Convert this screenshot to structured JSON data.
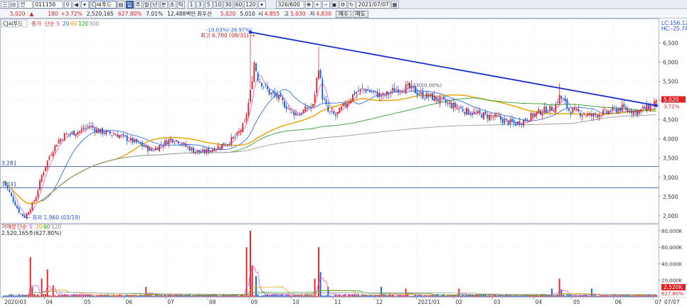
{
  "toolbar": {
    "menu_buttons": [
      "三",
      "⊟"
    ],
    "market": "전",
    "code": "011150",
    "stock_name": "CJ씨푸드",
    "periods": [
      "주",
      "월",
      "년",
      "분",
      "초",
      "틱"
    ],
    "intervals": [
      "1",
      "3",
      "5",
      "10",
      "30",
      "60",
      "120"
    ],
    "candle_count": "326/600",
    "date": "2021/07/07"
  },
  "quote": {
    "price": "5,020",
    "arrow": "▲",
    "change": "180",
    "change_pct": "+3.72%",
    "volume": "2,520,165",
    "vol_ratio": "627.80%",
    "turnover": "7.01%",
    "amount": "12,488백만",
    "bid_label": "최우선",
    "ask_price": "5,020",
    "bid_price": "5,010",
    "high_label": "시",
    "open": "4,855",
    "high2_label": "고",
    "high": "5,030",
    "low_label": "저",
    "low": "4,830",
    "buy_label": "매수",
    "sell_label": "매도"
  },
  "chart_data": {
    "type": "candlestick",
    "title": "CJ씨푸드",
    "price_legend": [
      "종가",
      "단순",
      "5",
      "20",
      "60",
      "120",
      "300"
    ],
    "volume_legend": [
      "거래량",
      "단순",
      "5",
      "20",
      "60",
      "120"
    ],
    "volume_value": "2,520,165주(627.80%)",
    "hc_label": "HC:-25.74",
    "lc_label": "LC:156.12",
    "y_ticks": [
      2000,
      2500,
      3000,
      3500,
      4000,
      4500,
      5000,
      5500,
      6000,
      6500
    ],
    "y_tick_labels": [
      "2,000",
      "2,500",
      "3,000",
      "3,500",
      "4,000",
      "4,500",
      "5,000",
      "5,500",
      "6,000",
      "6,500"
    ],
    "ylim": [
      1850,
      7100
    ],
    "vol_ticks": [
      20000,
      40000,
      60000,
      80000
    ],
    "vol_tick_labels": [
      "20,000K",
      "40,000K",
      "60,000K",
      "80,000K"
    ],
    "vol_max": 86000,
    "x_labels": [
      "2020/03",
      "04",
      "05",
      "06",
      "07",
      "08",
      "09",
      "10",
      "11",
      "12",
      "2021/01",
      "02",
      "03",
      "04",
      "05",
      "06",
      "07"
    ],
    "last_x_label": "07/07",
    "current_price": 5020,
    "current_price_label": "5,020",
    "current_pct_label": "3.72%",
    "current_vol_label": "2,520K",
    "current_vol_pct_label": "627.80%",
    "annotations": {
      "high": {
        "label": "최고 6,780 (08/31)",
        "pct": "-10.03%(-26.97%)",
        "value": 6780
      },
      "low": {
        "label": "최저 1,960 (03/19)",
        "value": 1960
      },
      "mid": {
        "label": "5,330(0.00%)",
        "value": 5330
      }
    },
    "hlines": [
      {
        "value": 3280,
        "label": "3,281"
      },
      {
        "value": 2730,
        "label": "3,031"
      }
    ],
    "trendline": {
      "from": 6780,
      "to": 4870
    },
    "anchor_points": [
      [
        0,
        2900
      ],
      [
        4,
        2500
      ],
      [
        8,
        2100
      ],
      [
        11,
        1960
      ],
      [
        14,
        2200
      ],
      [
        17,
        2500
      ],
      [
        20,
        3050
      ],
      [
        24,
        3550
      ],
      [
        28,
        3900
      ],
      [
        32,
        4100
      ],
      [
        36,
        4150
      ],
      [
        40,
        4200
      ],
      [
        45,
        4350
      ],
      [
        50,
        4200
      ],
      [
        55,
        4150
      ],
      [
        60,
        4100
      ],
      [
        65,
        4000
      ],
      [
        70,
        3900
      ],
      [
        74,
        3800
      ],
      [
        78,
        3700
      ],
      [
        83,
        3850
      ],
      [
        88,
        4000
      ],
      [
        92,
        3950
      ],
      [
        96,
        3800
      ],
      [
        100,
        3700
      ],
      [
        104,
        3650
      ],
      [
        108,
        3700
      ],
      [
        113,
        3800
      ],
      [
        118,
        3900
      ],
      [
        123,
        4100
      ],
      [
        127,
        4400
      ],
      [
        130,
        5200
      ],
      [
        132,
        6000
      ],
      [
        134,
        5600
      ],
      [
        137,
        5400
      ],
      [
        140,
        5200
      ],
      [
        144,
        5100
      ],
      [
        148,
        4900
      ],
      [
        152,
        4700
      ],
      [
        156,
        4650
      ],
      [
        160,
        4800
      ],
      [
        163,
        4850
      ],
      [
        166,
        5900
      ],
      [
        168,
        5100
      ],
      [
        171,
        4700
      ],
      [
        175,
        4600
      ],
      [
        180,
        4900
      ],
      [
        185,
        5200
      ],
      [
        190,
        5300
      ],
      [
        195,
        5200
      ],
      [
        200,
        5100
      ],
      [
        205,
        5250
      ],
      [
        210,
        5350
      ],
      [
        215,
        5300
      ],
      [
        220,
        5150
      ],
      [
        225,
        5100
      ],
      [
        230,
        5000
      ],
      [
        235,
        4900
      ],
      [
        240,
        4800
      ],
      [
        245,
        4700
      ],
      [
        250,
        4650
      ],
      [
        255,
        4600
      ],
      [
        260,
        4550
      ],
      [
        265,
        4450
      ],
      [
        270,
        4400
      ],
      [
        275,
        4500
      ],
      [
        280,
        4650
      ],
      [
        285,
        4750
      ],
      [
        290,
        4800
      ],
      [
        293,
        5100
      ],
      [
        295,
        5000
      ],
      [
        298,
        4750
      ],
      [
        302,
        4700
      ],
      [
        306,
        4650
      ],
      [
        310,
        4600
      ],
      [
        314,
        4650
      ],
      [
        318,
        4700
      ],
      [
        322,
        4750
      ],
      [
        326,
        4800
      ],
      [
        330,
        4750
      ],
      [
        334,
        4700
      ],
      [
        338,
        4800
      ],
      [
        341,
        4870
      ],
      [
        343,
        4950
      ],
      [
        344,
        5020
      ]
    ],
    "volume_spikes": [
      [
        14,
        48000
      ],
      [
        15,
        12000
      ],
      [
        20,
        22000
      ],
      [
        23,
        33000
      ],
      [
        26,
        14000
      ],
      [
        75,
        12000
      ],
      [
        128,
        60000
      ],
      [
        130,
        80000
      ],
      [
        131,
        38000
      ],
      [
        133,
        25000
      ],
      [
        164,
        22000
      ],
      [
        166,
        60000
      ],
      [
        167,
        30000
      ],
      [
        171,
        12000
      ],
      [
        199,
        12000
      ],
      [
        212,
        10000
      ],
      [
        240,
        10000
      ],
      [
        289,
        10000
      ],
      [
        293,
        22000
      ],
      [
        294,
        9000
      ],
      [
        310,
        10000
      ]
    ]
  }
}
